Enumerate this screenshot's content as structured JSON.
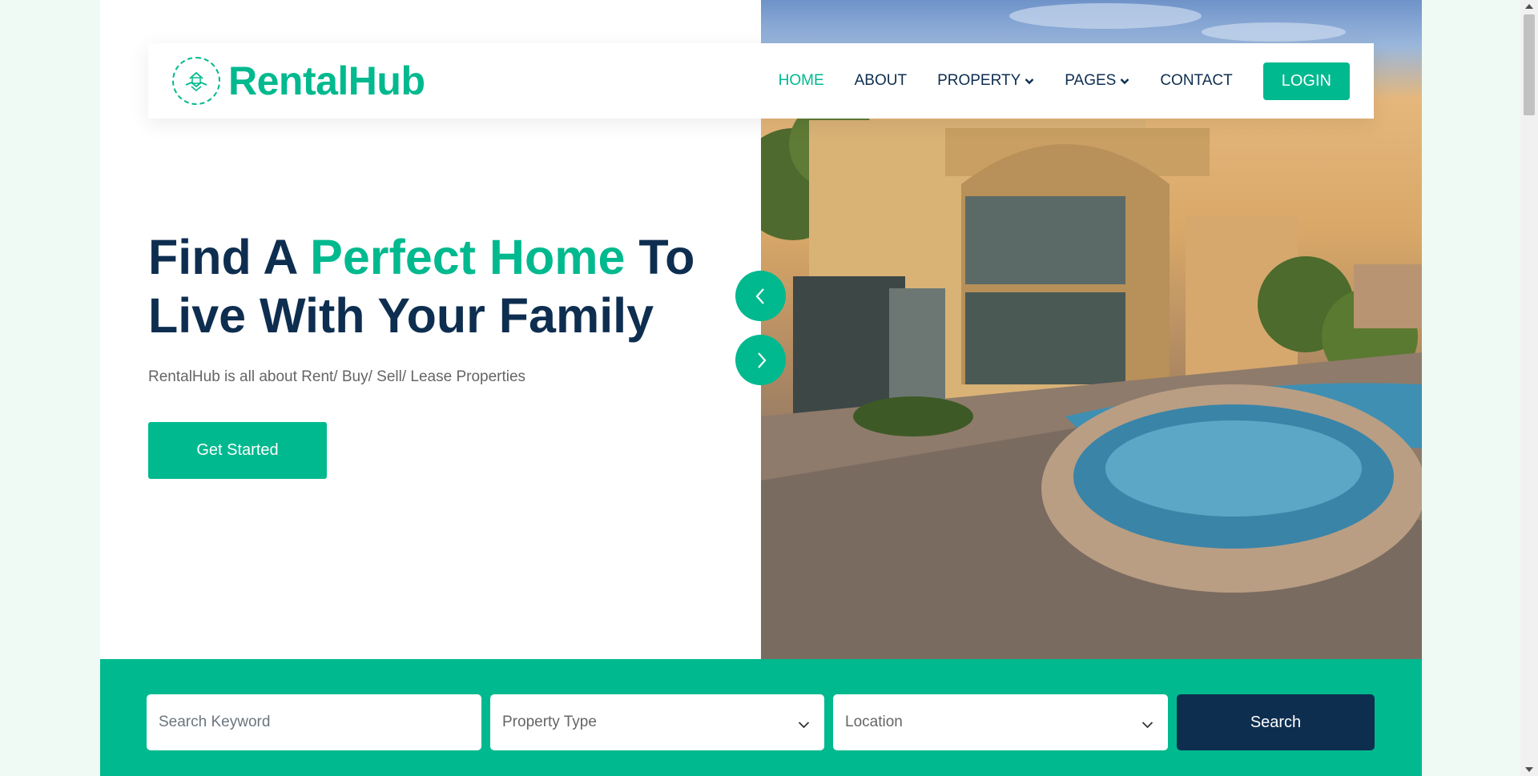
{
  "brand": {
    "name": "RentalHub",
    "logo_icon": "handshake-house-icon",
    "accent": "#00b98e",
    "dark": "#0e2e50"
  },
  "nav": {
    "items": [
      {
        "label": "HOME",
        "active": true
      },
      {
        "label": "ABOUT"
      },
      {
        "label": "PROPERTY",
        "dropdown": true
      },
      {
        "label": "PAGES",
        "dropdown": true
      },
      {
        "label": "CONTACT"
      }
    ],
    "login_label": "LOGIN"
  },
  "hero": {
    "title_part1": "Find A ",
    "title_accent": "Perfect Home",
    "title_part2": " To Live With Your Family",
    "subtitle": "RentalHub is all about Rent/ Buy/ Sell/ Lease Properties",
    "cta_label": "Get Started",
    "prev_icon": "chevron-left-icon",
    "next_icon": "chevron-right-icon"
  },
  "search": {
    "keyword_placeholder": "Search Keyword",
    "property_type_value": "Property Type",
    "location_value": "Location",
    "button_label": "Search"
  }
}
